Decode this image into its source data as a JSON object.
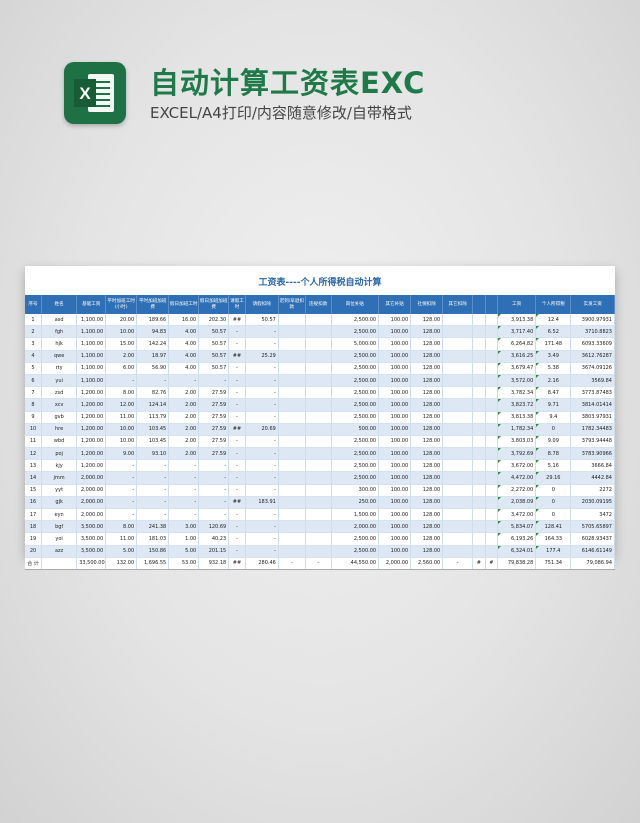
{
  "header": {
    "title": "自动计算工资表EXC",
    "subtitle": "EXCEL/A4打印/内容随意修改/自带格式",
    "logo_icon": "excel-icon",
    "logo_letter": "X"
  },
  "sheet": {
    "title": "工资表----个人所得税自动计算",
    "columns": [
      "序号",
      "姓名",
      "基础工资",
      "平时加班工时(小时)",
      "平时加班加班费",
      "假日加班工时",
      "假日加班加班费",
      "请假工时",
      "请假扣除",
      "迟到/早退扣款",
      "违规扣款",
      "岗位补贴",
      "其它补贴",
      "社保扣除",
      "其它扣除",
      "",
      "",
      "工资",
      "个人所得税",
      "实发工资"
    ],
    "rows": [
      [
        "1",
        "asd",
        "1,100.00",
        "20.00",
        "189.66",
        "16.00",
        "202.30",
        "##",
        "50.57",
        "",
        "",
        "2,500.00",
        "100.00",
        "128.00",
        "",
        "",
        "",
        "3,913.38",
        "12.4",
        "3900.97931"
      ],
      [
        "2",
        "fgh",
        "1,100.00",
        "10.00",
        "94.83",
        "4.00",
        "50.57",
        "-",
        "-",
        "",
        "",
        "2,500.00",
        "100.00",
        "128.00",
        "",
        "",
        "",
        "3,717.40",
        "6.52",
        "3710.8823"
      ],
      [
        "3",
        "hjk",
        "1,100.00",
        "15.00",
        "142.24",
        "4.00",
        "50.57",
        "-",
        "-",
        "",
        "",
        "5,000.00",
        "100.00",
        "128.00",
        "",
        "",
        "",
        "6,264.82",
        "171.48",
        "6093.33609"
      ],
      [
        "4",
        "qwe",
        "1,100.00",
        "2.00",
        "18.97",
        "4.00",
        "50.57",
        "##",
        "25.29",
        "",
        "",
        "2,500.00",
        "100.00",
        "128.00",
        "",
        "",
        "",
        "3,616.25",
        "3.49",
        "3612.76287"
      ],
      [
        "5",
        "rty",
        "1,100.00",
        "6.00",
        "56.90",
        "4.00",
        "50.57",
        "-",
        "-",
        "",
        "",
        "2,500.00",
        "100.00",
        "128.00",
        "",
        "",
        "",
        "3,679.47",
        "5.38",
        "3674.09126"
      ],
      [
        "6",
        "yui",
        "1,100.00",
        "-",
        "-",
        "-",
        "-",
        "-",
        "-",
        "",
        "",
        "2,500.00",
        "100.00",
        "128.00",
        "",
        "",
        "",
        "3,572.00",
        "2.16",
        "3569.84"
      ],
      [
        "7",
        "zsd",
        "1,200.00",
        "8.00",
        "82.76",
        "2.00",
        "27.59",
        "-",
        "-",
        "",
        "",
        "2,500.00",
        "100.00",
        "128.00",
        "",
        "",
        "",
        "3,782.34",
        "8.47",
        "3773.87483"
      ],
      [
        "8",
        "xcv",
        "1,200.00",
        "12.00",
        "124.14",
        "2.00",
        "27.59",
        "-",
        "-",
        "",
        "",
        "2,500.00",
        "100.00",
        "128.00",
        "",
        "",
        "",
        "3,823.72",
        "9.71",
        "3814.01414"
      ],
      [
        "9",
        "gvb",
        "1,200.00",
        "11.00",
        "113.79",
        "2.00",
        "27.59",
        "-",
        "-",
        "",
        "",
        "2,500.00",
        "100.00",
        "128.00",
        "",
        "",
        "",
        "3,813.38",
        "9.4",
        "3803.97931"
      ],
      [
        "10",
        "hre",
        "1,200.00",
        "10.00",
        "103.45",
        "2.00",
        "27.59",
        "##",
        "20.69",
        "",
        "",
        "500.00",
        "100.00",
        "128.00",
        "",
        "",
        "",
        "1,782.34",
        "0",
        "1782.34483"
      ],
      [
        "11",
        "wbd",
        "1,200.00",
        "10.00",
        "103.45",
        "2.00",
        "27.59",
        "-",
        "-",
        "",
        "",
        "2,500.00",
        "100.00",
        "128.00",
        "",
        "",
        "",
        "3,803.03",
        "9.09",
        "3793.94448"
      ],
      [
        "12",
        "poj",
        "1,200.00",
        "9.00",
        "93.10",
        "2.00",
        "27.59",
        "-",
        "-",
        "",
        "",
        "2,500.00",
        "100.00",
        "128.00",
        "",
        "",
        "",
        "3,792.69",
        "8.78",
        "3783.90966"
      ],
      [
        "13",
        "kjy",
        "1,200.00",
        "-",
        "-",
        "-",
        "-",
        "-",
        "-",
        "",
        "",
        "2,500.00",
        "100.00",
        "128.00",
        "",
        "",
        "",
        "3,672.00",
        "5.16",
        "3666.84"
      ],
      [
        "14",
        "jmm",
        "2,000.00",
        "-",
        "-",
        "-",
        "-",
        "-",
        "-",
        "",
        "",
        "2,500.00",
        "100.00",
        "128.00",
        "",
        "",
        "",
        "4,472.00",
        "29.16",
        "4442.84"
      ],
      [
        "15",
        "yyt",
        "2,000.00",
        "-",
        "-",
        "-",
        "-",
        "-",
        "-",
        "",
        "",
        "300.00",
        "100.00",
        "128.00",
        "",
        "",
        "",
        "2,272.00",
        "0",
        "2272"
      ],
      [
        "16",
        "gjk",
        "2,000.00",
        "-",
        "-",
        "-",
        "-",
        "##",
        "183.91",
        "",
        "",
        "250.00",
        "100.00",
        "128.00",
        "",
        "",
        "",
        "2,038.09",
        "0",
        "2030.09195"
      ],
      [
        "17",
        "eyn",
        "2,000.00",
        "-",
        "-",
        "-",
        "-",
        "-",
        "-",
        "",
        "",
        "1,500.00",
        "100.00",
        "128.00",
        "",
        "",
        "",
        "3,472.00",
        "0",
        "3472"
      ],
      [
        "18",
        "bgf",
        "3,500.00",
        "8.00",
        "241.38",
        "3.00",
        "120.69",
        "-",
        "-",
        "",
        "",
        "2,000.00",
        "100.00",
        "128.00",
        "",
        "",
        "",
        "5,834.07",
        "128.41",
        "5705.65897"
      ],
      [
        "19",
        "yoi",
        "3,500.00",
        "11.00",
        "181.03",
        "1.00",
        "40.23",
        "-",
        "-",
        "",
        "",
        "2,500.00",
        "100.00",
        "128.00",
        "",
        "",
        "",
        "6,193.26",
        "164.33",
        "6028.93437"
      ],
      [
        "20",
        "azz",
        "3,500.00",
        "5.00",
        "150.86",
        "5.00",
        "201.15",
        "-",
        "-",
        "",
        "",
        "2,500.00",
        "100.00",
        "128.00",
        "",
        "",
        "",
        "6,324.01",
        "177.4",
        "6146.61149"
      ]
    ],
    "total": [
      "合 计",
      "",
      "33,500.00",
      "132.00",
      "1,696.55",
      "53.00",
      "932.18",
      "##",
      "280.46",
      "-",
      "-",
      "44,550.00",
      "2,000.00",
      "2,560.00",
      "-",
      "#",
      "#",
      "79,838.28",
      "751.34",
      "79,086.94"
    ]
  }
}
